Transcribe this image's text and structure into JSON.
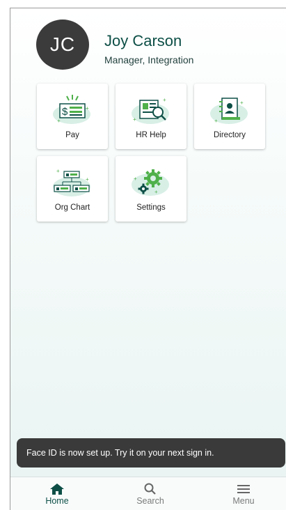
{
  "profile": {
    "initials": "JC",
    "name": "Joy Carson",
    "title": "Manager, Integration"
  },
  "tiles": [
    {
      "label": "Pay",
      "icon": "pay-icon"
    },
    {
      "label": "HR Help",
      "icon": "hr-help-icon"
    },
    {
      "label": "Directory",
      "icon": "directory-icon"
    },
    {
      "label": "Org Chart",
      "icon": "org-chart-icon"
    },
    {
      "label": "Settings",
      "icon": "settings-icon"
    }
  ],
  "toast": {
    "message": "Face ID is now set up. Try it on your next sign in."
  },
  "nav": {
    "home": "Home",
    "search": "Search",
    "menu": "Menu"
  },
  "colors": {
    "brand": "#0d4f46",
    "accent": "#5ab84d",
    "avatar": "#3b3b3b",
    "toast": "#3a3a3a"
  }
}
